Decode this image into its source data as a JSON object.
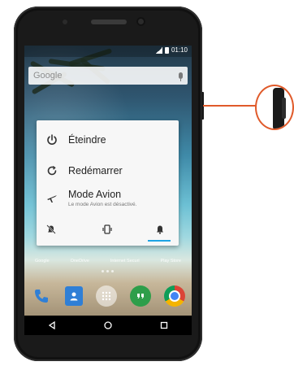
{
  "status_bar": {
    "time": "01:10"
  },
  "search_bar": {
    "label": "Google"
  },
  "power_menu": {
    "power_off_label": "Éteindre",
    "restart_label": "Redémarrer",
    "airplane_label": "Mode Avion",
    "airplane_status": "Le mode Avion est désactivé.",
    "selected_mode": "sound"
  },
  "home_labels": [
    "Google",
    "OneDrive",
    "Internet Securi",
    "Play Store"
  ],
  "colors": {
    "accent": "#1ea4e4",
    "callout": "#e05a2a"
  }
}
